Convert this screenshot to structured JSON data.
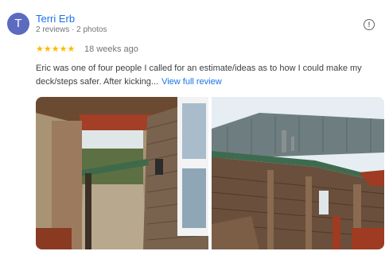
{
  "review": {
    "avatar_letter": "T",
    "reviewer_name": "Terri Erb",
    "reviewer_meta": "2 reviews · 2 photos",
    "rating": 5,
    "stars_text": "★★★★★",
    "time_ago": "18 weeks ago",
    "text": "Eric was one of four people I called for an estimate/ideas as to how I could make my deck/steps safer. After kicking...",
    "view_full_label": "View full review",
    "more_icon": "info-icon"
  },
  "colors": {
    "name_link": "#1a73e8",
    "avatar_bg": "#5c6bc0",
    "star": "#fbbc04"
  }
}
